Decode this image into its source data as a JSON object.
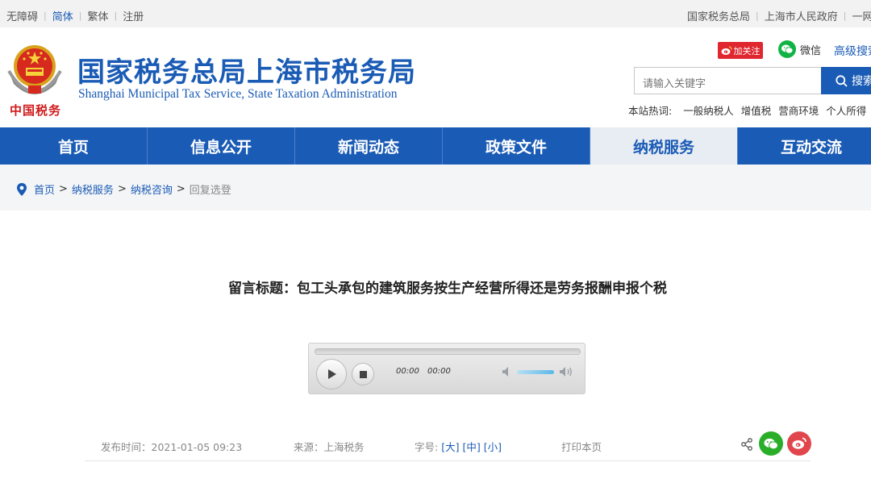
{
  "topbar": {
    "left_links": [
      "无障碍",
      "简体",
      "繁体",
      "注册"
    ],
    "right_links": [
      "国家税务总局",
      "上海市人民政府",
      "一网通"
    ]
  },
  "header": {
    "emblem_text": "中国税务",
    "title": "国家税务总局上海市税务局",
    "subtitle": "Shanghai Municipal Tax Service, State Taxation Administration",
    "follow_label": "加关注",
    "wechat_label": "微信",
    "advanced_search": "高级搜索",
    "search_placeholder": "请输入关键字",
    "search_button": "搜索",
    "hot_label": "本站热词:",
    "hot_words": [
      "一般纳税人",
      "增值税",
      "营商环境",
      "个人所得"
    ]
  },
  "nav": {
    "items": [
      "首页",
      "信息公开",
      "新闻动态",
      "政策文件",
      "纳税服务",
      "互动交流"
    ],
    "active_index": 4
  },
  "breadcrumb": {
    "links": [
      "首页",
      "纳税服务",
      "纳税咨询"
    ],
    "current": "回复选登"
  },
  "article": {
    "title": "留言标题：包工头承包的建筑服务按生产经营所得还是劳务报酬申报个税",
    "player": {
      "current_time": "00:00",
      "duration": "00:00",
      "progress": 0,
      "volume": 0.85
    },
    "meta": {
      "publish": "发布时间：2021-01-05 09:23",
      "source": "来源：上海税务",
      "font_label": "字号:",
      "font_large": "大",
      "font_medium": "中",
      "font_small": "小",
      "print": "打印本页"
    }
  },
  "colors": {
    "brand_blue": "#1a5bb5",
    "weibo_red": "#e0262f",
    "wechat_green": "#12b346"
  }
}
